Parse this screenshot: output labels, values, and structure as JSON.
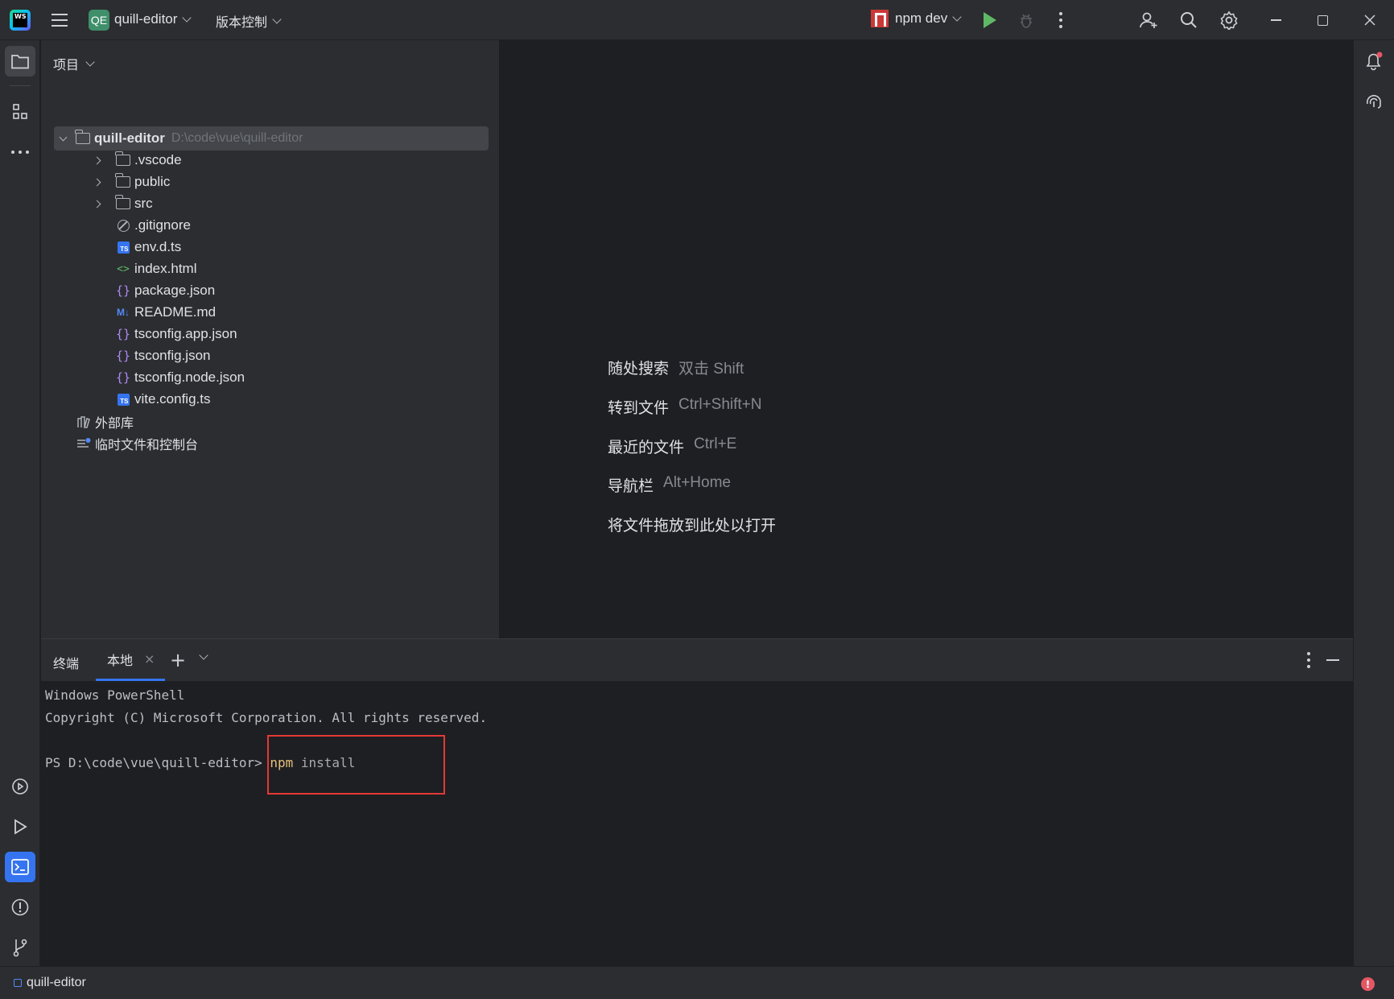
{
  "titlebar": {
    "project_badge": "QE",
    "project_name": "quill-editor",
    "vcs_label": "版本控制",
    "run_config": "npm dev"
  },
  "project_panel": {
    "title": "项目",
    "root": {
      "name": "quill-editor",
      "path": "D:\\code\\vue\\quill-editor"
    },
    "items": [
      {
        "name": ".vscode",
        "type": "folder"
      },
      {
        "name": "public",
        "type": "folder"
      },
      {
        "name": "src",
        "type": "folder"
      },
      {
        "name": ".gitignore",
        "type": "ignore"
      },
      {
        "name": "env.d.ts",
        "type": "ts"
      },
      {
        "name": "index.html",
        "type": "html"
      },
      {
        "name": "package.json",
        "type": "json"
      },
      {
        "name": "README.md",
        "type": "md"
      },
      {
        "name": "tsconfig.app.json",
        "type": "json"
      },
      {
        "name": "tsconfig.json",
        "type": "json"
      },
      {
        "name": "tsconfig.node.json",
        "type": "json"
      },
      {
        "name": "vite.config.ts",
        "type": "ts"
      }
    ],
    "external_libs": "外部库",
    "scratches": "临时文件和控制台"
  },
  "editor_hints": [
    {
      "label": "随处搜索",
      "key": "双击 Shift"
    },
    {
      "label": "转到文件",
      "key": "Ctrl+Shift+N"
    },
    {
      "label": "最近的文件",
      "key": "Ctrl+E"
    },
    {
      "label": "导航栏",
      "key": "Alt+Home"
    },
    {
      "label": "将文件拖放到此处以打开",
      "key": ""
    }
  ],
  "terminal": {
    "title": "终端",
    "tab": "本地",
    "lines": [
      "Windows PowerShell",
      "Copyright (C) Microsoft Corporation. All rights reserved."
    ],
    "prompt": "PS D:\\code\\vue\\quill-editor> ",
    "cmd": "npm",
    "args": " install"
  },
  "statusbar": {
    "project": "quill-editor"
  },
  "colors": {
    "accent": "#3574f0",
    "highlight": "#e53935",
    "run": "#5fb865"
  }
}
